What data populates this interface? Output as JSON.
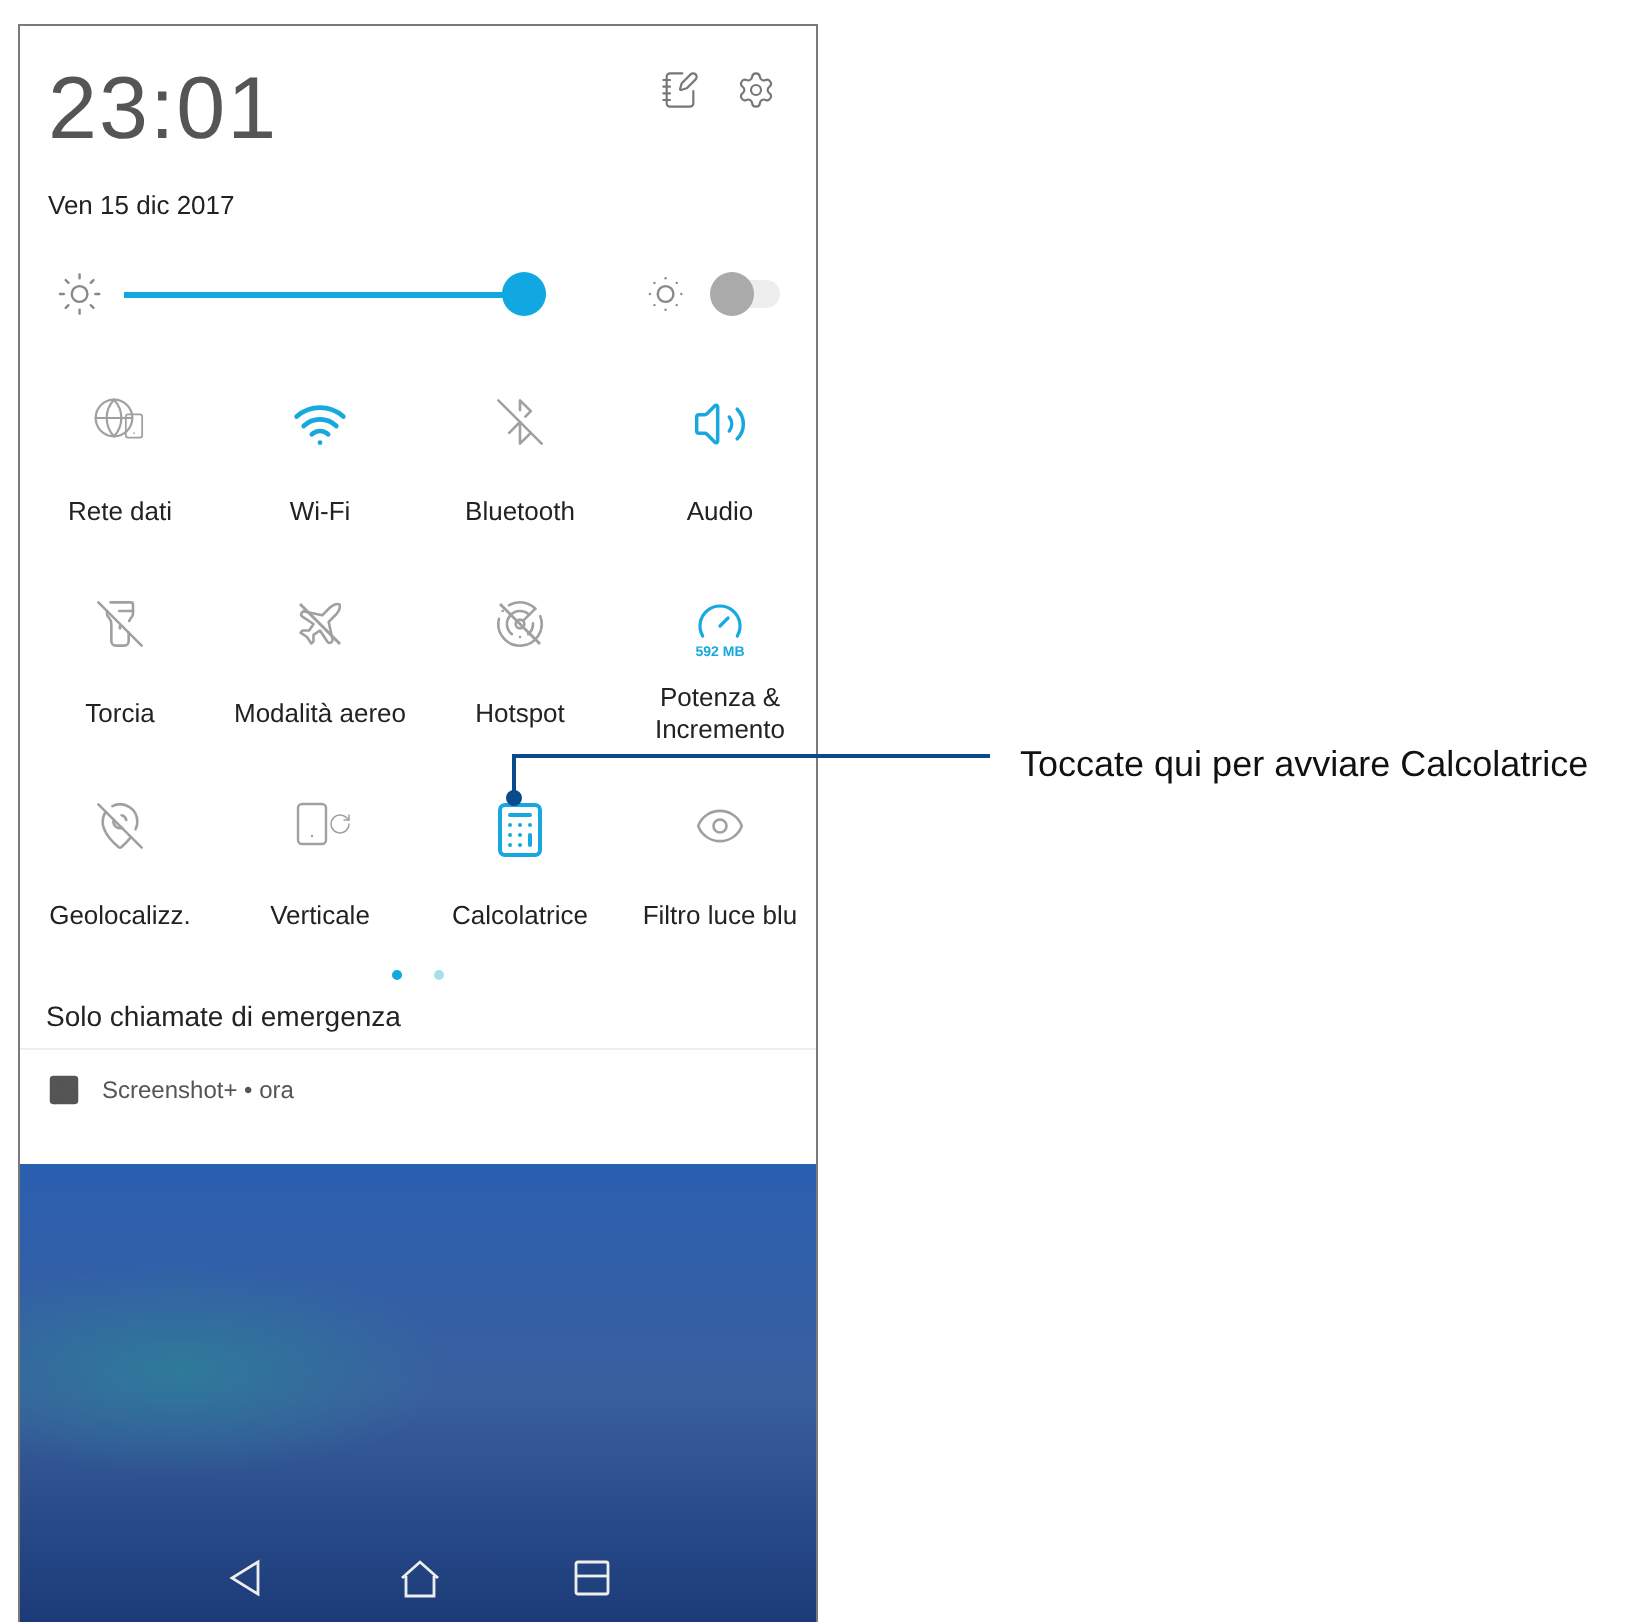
{
  "status": {
    "time": "23:01",
    "date": "Ven 15 dic 2017"
  },
  "brightness": {
    "level": 1.0,
    "auto": false
  },
  "tiles": [
    {
      "label": "Rete dati",
      "on": false
    },
    {
      "label": "Wi-Fi",
      "on": true
    },
    {
      "label": "Bluetooth",
      "on": false
    },
    {
      "label": "Audio",
      "on": true
    },
    {
      "label": "Torcia",
      "on": false
    },
    {
      "label": "Modalità aereo",
      "on": false
    },
    {
      "label": "Hotspot",
      "on": false
    },
    {
      "label": "Potenza & Incremento",
      "on": true,
      "reading": "592 MB"
    },
    {
      "label": "Geolocalizz.",
      "on": false
    },
    {
      "label": "Verticale",
      "on": false
    },
    {
      "label": "Calcolatrice",
      "on": true
    },
    {
      "label": "Filtro luce blu",
      "on": false
    }
  ],
  "pages": [
    {
      "selected": true
    },
    {
      "selected": false
    }
  ],
  "carrier": "Solo chiamate di emergenza",
  "notification": {
    "app": "Screenshot+ • ora"
  },
  "callout": {
    "text": "Toccate qui per avviare Calcolatrice"
  }
}
